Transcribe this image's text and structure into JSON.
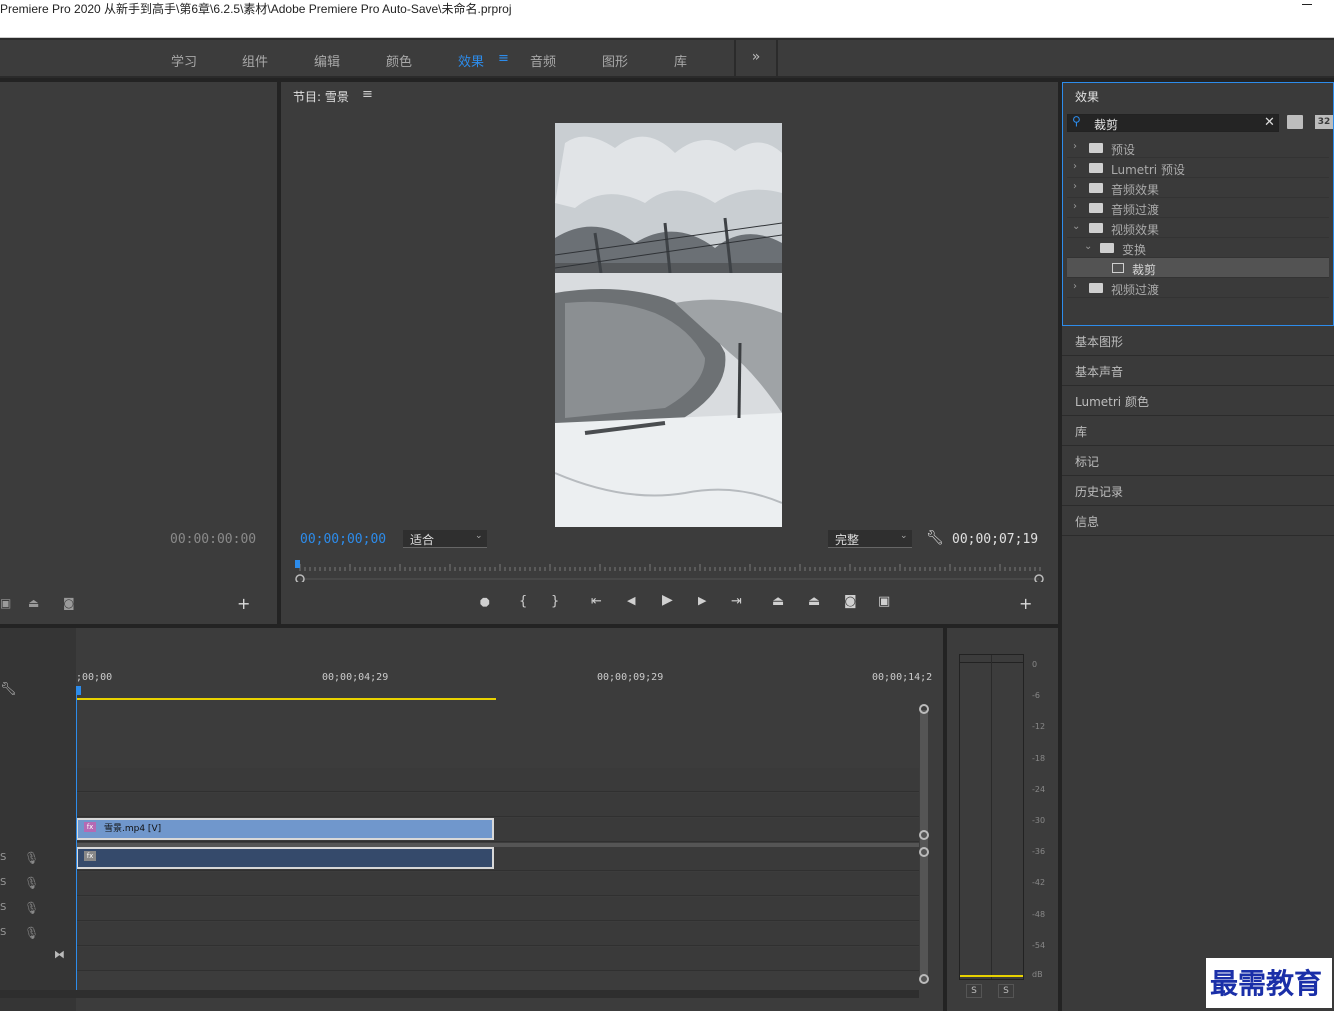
{
  "window": {
    "title": "Premiere Pro 2020 从新手到高手\\第6章\\6.2.5\\素材\\Adobe Premiere Pro Auto-Save\\未命名.prproj"
  },
  "workspaces": {
    "tabs": [
      {
        "label": "学习"
      },
      {
        "label": "组件"
      },
      {
        "label": "编辑"
      },
      {
        "label": "颜色"
      },
      {
        "label": "效果",
        "active": true
      },
      {
        "label": "音频"
      },
      {
        "label": "图形"
      },
      {
        "label": "库"
      }
    ],
    "menu_icon": "hamburger-icon",
    "overflow_label": "»"
  },
  "source": {
    "timecode": "00:00:00:00"
  },
  "program": {
    "title": "节目: 雪景",
    "menu_icon": "hamburger-icon",
    "current_time": "00;00;00;00",
    "zoom_select": "适合",
    "quality_select": "完整",
    "duration": "00;00;07;19",
    "add_label": "+"
  },
  "effects": {
    "title": "效果",
    "search_value": "裁剪",
    "tree": [
      {
        "label": "预设",
        "level": 0,
        "expanded": false
      },
      {
        "label": "Lumetri 预设",
        "level": 0,
        "expanded": false
      },
      {
        "label": "音频效果",
        "level": 0,
        "expanded": false
      },
      {
        "label": "音频过渡",
        "level": 0,
        "expanded": false
      },
      {
        "label": "视频效果",
        "level": 0,
        "expanded": true
      },
      {
        "label": "变换",
        "level": 1,
        "expanded": true
      },
      {
        "label": "裁剪",
        "level": 2,
        "selected": true
      },
      {
        "label": "视频过渡",
        "level": 0,
        "expanded": false
      }
    ],
    "badge_32": "32"
  },
  "right_panels": [
    "基本图形",
    "基本声音",
    "Lumetri 颜色",
    "库",
    "标记",
    "历史记录",
    "信息"
  ],
  "timeline": {
    "ruler": [
      ";00;00",
      "00;00;04;29",
      "00;00;09;29",
      "00;00;14;2"
    ],
    "clip_video_label": "雪景.mp4 [V]",
    "clip_fx": "fx",
    "track_s": "S"
  },
  "meter": {
    "scale": [
      "0",
      "-6",
      "-12",
      "-18",
      "-24",
      "-30",
      "-36",
      "-42",
      "-48",
      "-54",
      "dB"
    ],
    "solo_labels": [
      "S",
      "S"
    ]
  },
  "watermark": {
    "text": "最需教育"
  },
  "colors": {
    "accent": "#2d8ceb",
    "panel": "#3c3c3c",
    "clip_video": "#7097cc",
    "clip_audio": "#354a6b",
    "work_area": "#e8d200"
  }
}
